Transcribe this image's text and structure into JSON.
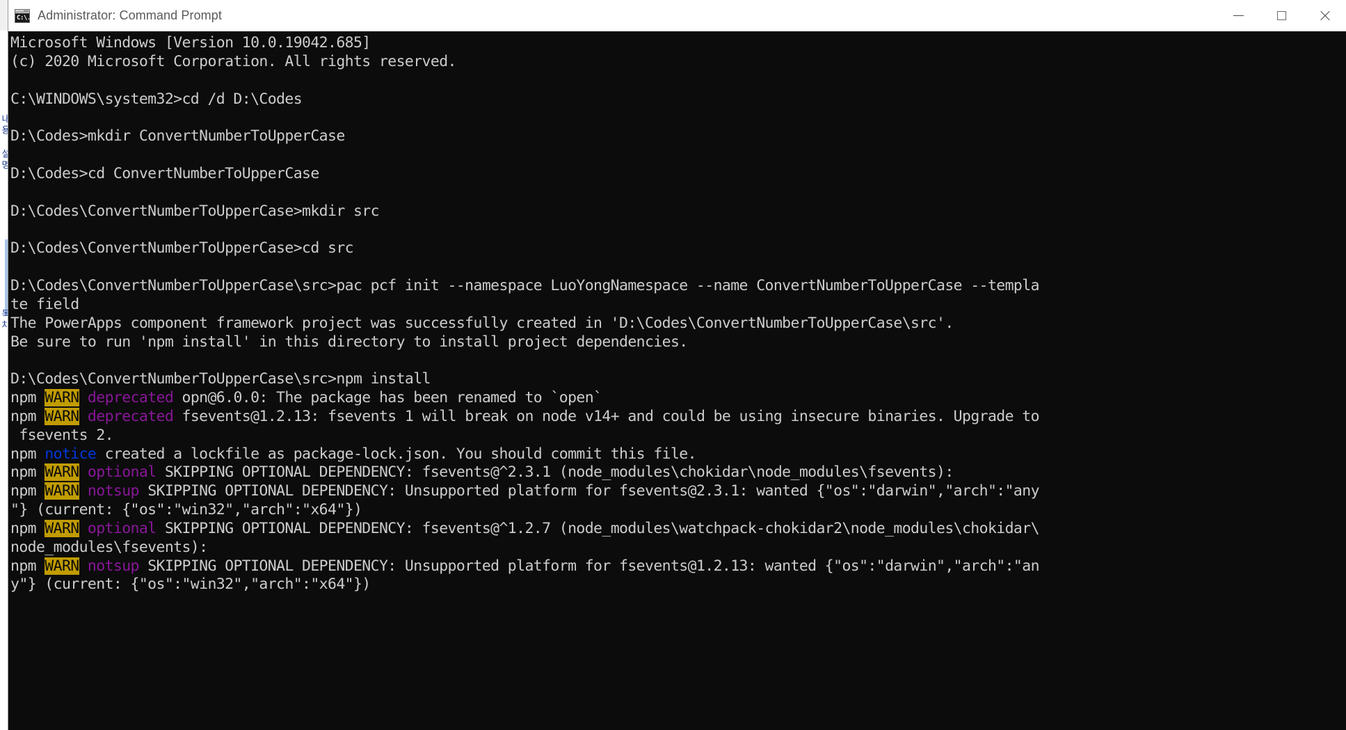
{
  "window": {
    "title": "Administrator: Command Prompt",
    "icon": "cmd-prompt-icon",
    "icon_text": "C:\\.",
    "controls": {
      "minimize": "minimize-button",
      "maximize": "maximize-button",
      "close": "close-button"
    }
  },
  "background_window": {
    "vertical_text_1": "내용 설명",
    "vertical_text_2": "목차"
  },
  "colors": {
    "titlebar_bg": "#ffffff",
    "title_text": "#5a5a5a",
    "terminal_bg": "#0c0c0c",
    "terminal_fg": "#cccccc",
    "warn_badge_bg": "#c19c00",
    "warn_badge_fg": "#0c0c0c",
    "magenta": "#881798",
    "blue": "#0037da"
  },
  "terminal": {
    "lines": [
      [
        {
          "t": "Microsoft Windows [Version 10.0.19042.685]",
          "c": "default"
        }
      ],
      [
        {
          "t": "(c) 2020 Microsoft Corporation. All rights reserved.",
          "c": "default"
        }
      ],
      [
        {
          "t": "",
          "c": "default"
        }
      ],
      [
        {
          "t": "C:\\WINDOWS\\system32>cd /d D:\\Codes",
          "c": "default"
        }
      ],
      [
        {
          "t": "",
          "c": "default"
        }
      ],
      [
        {
          "t": "D:\\Codes>mkdir ConvertNumberToUpperCase",
          "c": "default"
        }
      ],
      [
        {
          "t": "",
          "c": "default"
        }
      ],
      [
        {
          "t": "D:\\Codes>cd ConvertNumberToUpperCase",
          "c": "default"
        }
      ],
      [
        {
          "t": "",
          "c": "default"
        }
      ],
      [
        {
          "t": "D:\\Codes\\ConvertNumberToUpperCase>mkdir src",
          "c": "default"
        }
      ],
      [
        {
          "t": "",
          "c": "default"
        }
      ],
      [
        {
          "t": "D:\\Codes\\ConvertNumberToUpperCase>cd src",
          "c": "default"
        }
      ],
      [
        {
          "t": "",
          "c": "default"
        }
      ],
      [
        {
          "t": "D:\\Codes\\ConvertNumberToUpperCase\\src>pac pcf init --namespace LuoYongNamespace --name ConvertNumberToUpperCase --templa",
          "c": "default"
        }
      ],
      [
        {
          "t": "te field",
          "c": "default"
        }
      ],
      [
        {
          "t": "The PowerApps component framework project was successfully created in 'D:\\Codes\\ConvertNumberToUpperCase\\src'.",
          "c": "default"
        }
      ],
      [
        {
          "t": "Be sure to run 'npm install' in this directory to install project dependencies.",
          "c": "default"
        }
      ],
      [
        {
          "t": "",
          "c": "default"
        }
      ],
      [
        {
          "t": "D:\\Codes\\ConvertNumberToUpperCase\\src>npm install",
          "c": "default"
        }
      ],
      [
        {
          "t": "npm ",
          "c": "default"
        },
        {
          "t": "WARN",
          "c": "warn"
        },
        {
          "t": " ",
          "c": "default"
        },
        {
          "t": "deprecated",
          "c": "magenta"
        },
        {
          "t": " opn@6.0.0: The package has been renamed to `open`",
          "c": "default"
        }
      ],
      [
        {
          "t": "npm ",
          "c": "default"
        },
        {
          "t": "WARN",
          "c": "warn"
        },
        {
          "t": " ",
          "c": "default"
        },
        {
          "t": "deprecated",
          "c": "magenta"
        },
        {
          "t": " fsevents@1.2.13: fsevents 1 will break on node v14+ and could be using insecure binaries. Upgrade to",
          "c": "default"
        }
      ],
      [
        {
          "t": " fsevents 2.",
          "c": "default"
        }
      ],
      [
        {
          "t": "npm ",
          "c": "default"
        },
        {
          "t": "notice",
          "c": "blue"
        },
        {
          "t": " created a lockfile as package-lock.json. You should commit this file.",
          "c": "default"
        }
      ],
      [
        {
          "t": "npm ",
          "c": "default"
        },
        {
          "t": "WARN",
          "c": "warn"
        },
        {
          "t": " ",
          "c": "default"
        },
        {
          "t": "optional",
          "c": "magenta"
        },
        {
          "t": " SKIPPING OPTIONAL DEPENDENCY: fsevents@^2.3.1 (node_modules\\chokidar\\node_modules\\fsevents):",
          "c": "default"
        }
      ],
      [
        {
          "t": "npm ",
          "c": "default"
        },
        {
          "t": "WARN",
          "c": "warn"
        },
        {
          "t": " ",
          "c": "default"
        },
        {
          "t": "notsup",
          "c": "magenta"
        },
        {
          "t": " SKIPPING OPTIONAL DEPENDENCY: Unsupported platform for fsevents@2.3.1: wanted {\"os\":\"darwin\",\"arch\":\"any",
          "c": "default"
        }
      ],
      [
        {
          "t": "\"} (current: {\"os\":\"win32\",\"arch\":\"x64\"})",
          "c": "default"
        }
      ],
      [
        {
          "t": "npm ",
          "c": "default"
        },
        {
          "t": "WARN",
          "c": "warn"
        },
        {
          "t": " ",
          "c": "default"
        },
        {
          "t": "optional",
          "c": "magenta"
        },
        {
          "t": " SKIPPING OPTIONAL DEPENDENCY: fsevents@^1.2.7 (node_modules\\watchpack-chokidar2\\node_modules\\chokidar\\",
          "c": "default"
        }
      ],
      [
        {
          "t": "node_modules\\fsevents):",
          "c": "default"
        }
      ],
      [
        {
          "t": "npm ",
          "c": "default"
        },
        {
          "t": "WARN",
          "c": "warn"
        },
        {
          "t": " ",
          "c": "default"
        },
        {
          "t": "notsup",
          "c": "magenta"
        },
        {
          "t": " SKIPPING OPTIONAL DEPENDENCY: Unsupported platform for fsevents@1.2.13: wanted {\"os\":\"darwin\",\"arch\":\"an",
          "c": "default"
        }
      ],
      [
        {
          "t": "y\"} (current: {\"os\":\"win32\",\"arch\":\"x64\"})",
          "c": "default"
        }
      ]
    ]
  }
}
